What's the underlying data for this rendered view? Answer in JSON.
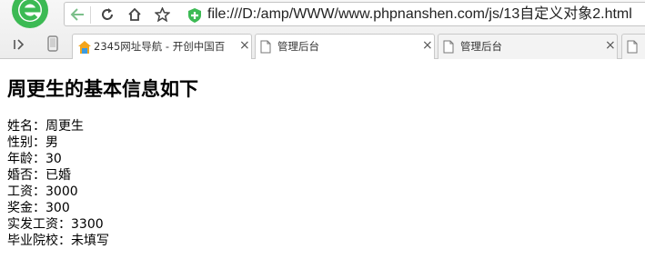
{
  "browser": {
    "url": "file:///D:/amp/WWW/www.phpnanshen.com/js/13自定义对象2.html",
    "logo_text": "2345",
    "tabs": [
      {
        "title": "2345网址导航 - 开创中国百",
        "close": "×"
      },
      {
        "title": "管理后台",
        "close": "×"
      },
      {
        "title": "管理后台",
        "close": "×"
      }
    ],
    "accent_color": "#3cba54"
  },
  "page": {
    "title": "周更生的基本信息如下",
    "rows": [
      "姓名：周更生",
      "性别：男",
      "年龄：30",
      "婚否：已婚",
      "工资：3000",
      "奖金：300",
      "实发工资：3300",
      "毕业院校：未填写"
    ]
  }
}
